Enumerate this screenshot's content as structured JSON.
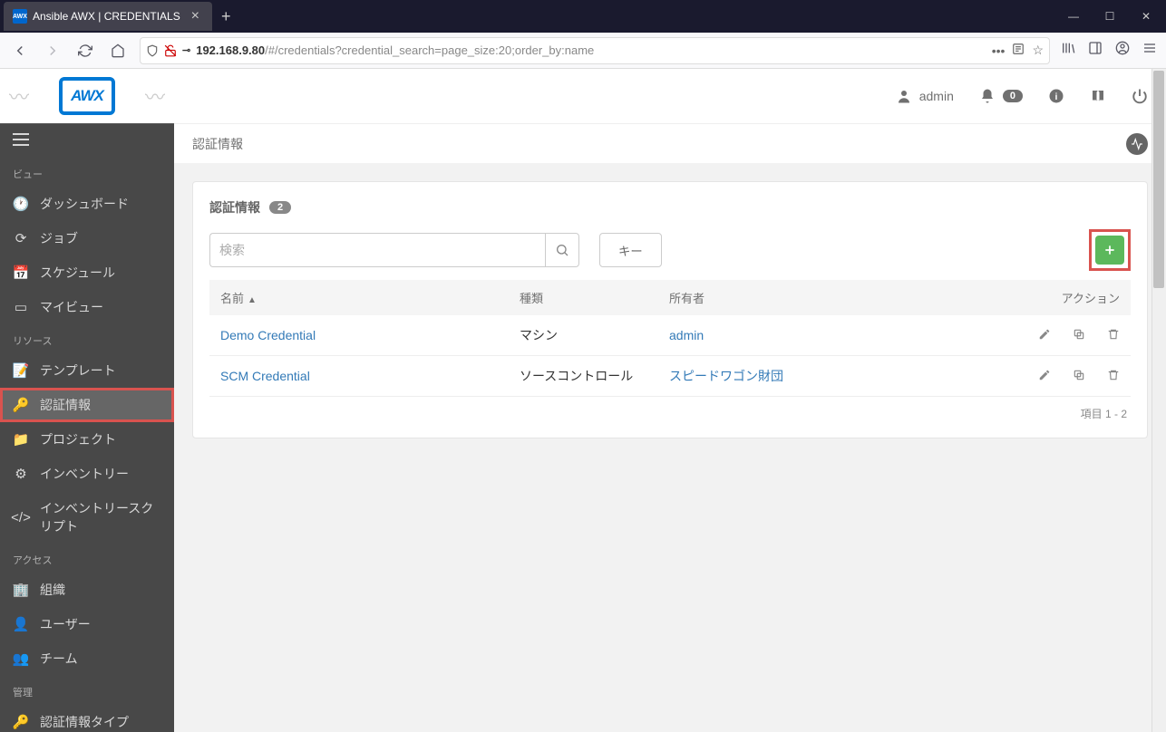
{
  "browser": {
    "tab_title": "Ansible AWX | CREDENTIALS",
    "url_domain": "192.168.9.80",
    "url_path": "/#/credentials?credential_search=page_size:20;order_by:name"
  },
  "header": {
    "user": "admin",
    "notification_count": "0"
  },
  "breadcrumb": "認証情報",
  "sidebar": {
    "sections": {
      "view": "ビュー",
      "resources": "リソース",
      "access": "アクセス",
      "admin": "管理"
    },
    "items": {
      "dashboard": "ダッシュボード",
      "jobs": "ジョブ",
      "schedules": "スケジュール",
      "my_view": "マイビュー",
      "templates": "テンプレート",
      "credentials": "認証情報",
      "projects": "プロジェクト",
      "inventories": "インベントリー",
      "inventory_scripts": "インベントリースクリプト",
      "organizations": "組織",
      "users": "ユーザー",
      "teams": "チーム",
      "credential_types": "認証情報タイプ"
    }
  },
  "panel": {
    "title": "認証情報",
    "count": "2",
    "search_placeholder": "検索",
    "key_button": "キー",
    "columns": {
      "name": "名前",
      "type": "種類",
      "owner": "所有者",
      "actions": "アクション"
    },
    "rows": [
      {
        "name": "Demo Credential",
        "type": "マシン",
        "owner": "admin"
      },
      {
        "name": "SCM Credential",
        "type": "ソースコントロール",
        "owner": "スピードワゴン財団"
      }
    ],
    "footer": "項目 1 - 2"
  }
}
